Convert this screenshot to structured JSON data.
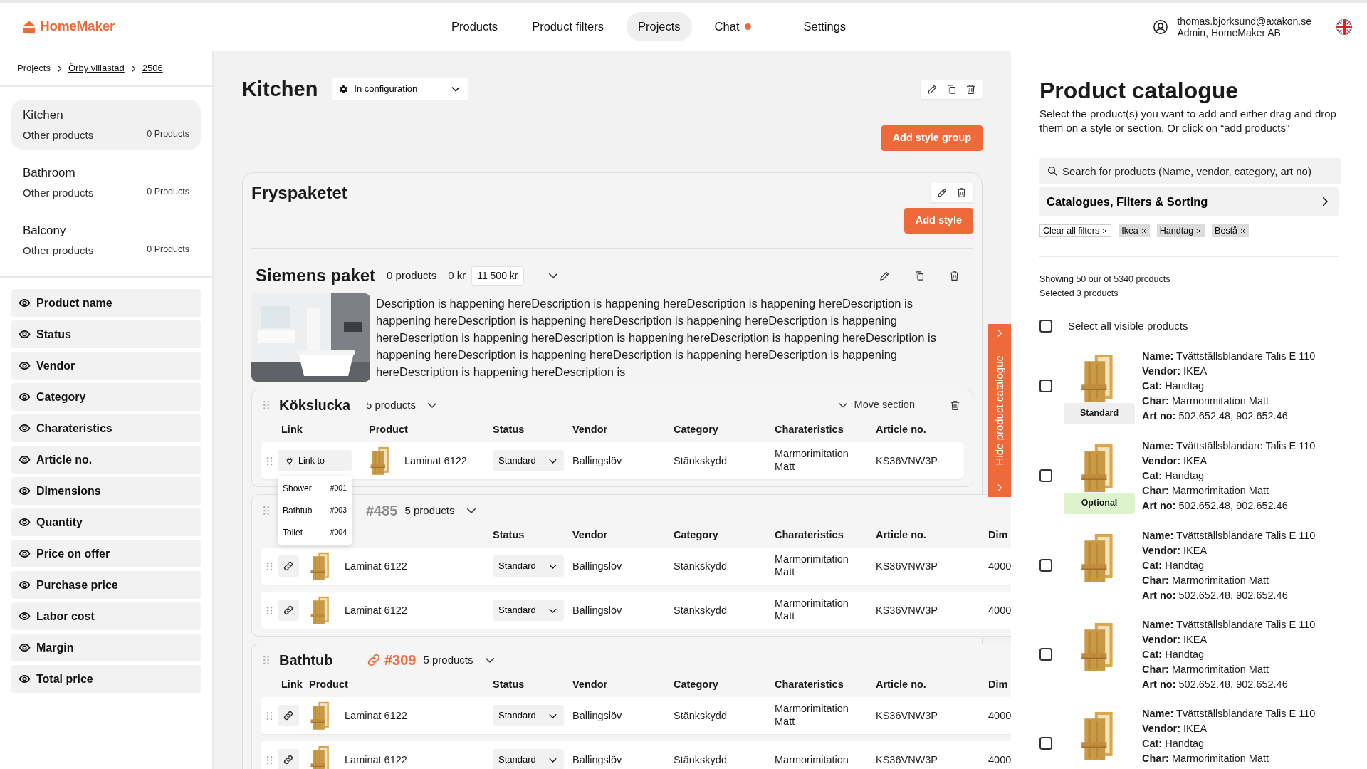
{
  "header": {
    "logo": "HomeMaker",
    "nav": [
      {
        "label": "Products",
        "selected": false,
        "unread": false
      },
      {
        "label": "Product filters",
        "selected": false,
        "unread": false
      },
      {
        "label": "Projects",
        "selected": true,
        "unread": false
      },
      {
        "label": "Chat",
        "selected": false,
        "unread": true
      }
    ],
    "settings": "Settings",
    "user": {
      "email": "thomas.bjorksund@axakon.se",
      "role": "Admin, HomeMaker AB"
    }
  },
  "breadcrumb": [
    {
      "label": "Projects",
      "link": false
    },
    {
      "label": "Örby villastad",
      "link": true
    },
    {
      "label": "2506",
      "link": true
    }
  ],
  "rooms": [
    {
      "name": "Kitchen",
      "label": "Other products",
      "count": "0 Products",
      "selected": true
    },
    {
      "name": "Bathroom",
      "label": "Other products",
      "count": "0 Products",
      "selected": false
    },
    {
      "name": "Balcony",
      "label": "Other products",
      "count": "0 Products",
      "selected": false
    }
  ],
  "column_toggles": [
    "Product name",
    "Status",
    "Vendor",
    "Category",
    "Charateristics",
    "Article no.",
    "Dimensions",
    "Quantity",
    "Price on offer",
    "Purchase price",
    "Labor cost",
    "Margin",
    "Total price"
  ],
  "room": {
    "title": "Kitchen",
    "status": "In configuration",
    "add_style_group": "Add style group"
  },
  "style_group": {
    "title": "Fryspaketet",
    "add_style": "Add style",
    "style": {
      "title": "Siemens paket",
      "products": "0 products",
      "price": "0 kr",
      "price_value": "11 500 kr",
      "description": "Description is happening hereDescription is happening hereDescription is happening hereDescription is happening hereDescription is happening hereDescription is happening hereDescription is happening hereDescription is happening hereDescription is happening hereDescription is happening hereDescription is happening hereDescription is happening hereDescription is happening hereDescription is happening hereDescription is happening hereDescription is",
      "sections": [
        {
          "title": "Kökslucka",
          "count": "5 products",
          "move": "Move section",
          "columns": [
            {
              "kind": "link",
              "label": "Link"
            },
            {
              "kind": "product",
              "label": "Product"
            },
            {
              "kind": "status",
              "label": "Status"
            },
            {
              "kind": "vendor",
              "label": "Vendor"
            },
            {
              "kind": "category",
              "label": "Category"
            },
            {
              "kind": "char",
              "label": "Charateristics"
            },
            {
              "kind": "article",
              "label": "Article no."
            }
          ],
          "rows": [
            {
              "name": "Laminat 6122",
              "status": "Standard",
              "vendor": "Ballingslöv",
              "category": "Stänkskydd",
              "characteristics": "Marmorimitation Matt",
              "article_no": "KS36VNW3P",
              "link_label": "Link to",
              "link_menu": [
                {
                  "name": "Shower",
                  "tag": "#001"
                },
                {
                  "name": "Bathtub",
                  "tag": "#003"
                },
                {
                  "name": "Toilet",
                  "tag": "#004"
                }
              ]
            }
          ]
        },
        {
          "tag": "#485",
          "linked": false,
          "count": "5 products",
          "columns": [
            {
              "kind": "status",
              "label": "Status"
            },
            {
              "kind": "vendor",
              "label": "Vendor"
            },
            {
              "kind": "category",
              "label": "Category"
            },
            {
              "kind": "char",
              "label": "Charateristics"
            },
            {
              "kind": "article",
              "label": "Article no."
            },
            {
              "kind": "dim",
              "label": "Dim"
            }
          ],
          "rows": [
            {
              "name": "Laminat 6122",
              "status": "Standard",
              "vendor": "Ballingslöv",
              "category": "Stänkskydd",
              "characteristics": "Marmorimitation Matt",
              "article_no": "KS36VNW3P",
              "dimensions": "4000"
            },
            {
              "name": "Laminat 6122",
              "status": "Standard",
              "vendor": "Ballingslöv",
              "category": "Stänkskydd",
              "characteristics": "Marmorimitation Matt",
              "article_no": "KS36VNW3P",
              "dimensions": "4000"
            }
          ]
        },
        {
          "title": "Bathtub",
          "tag": "#309",
          "linked": true,
          "count": "5 products",
          "columns": [
            {
              "kind": "link",
              "label": "Link"
            },
            {
              "kind": "product",
              "label": "Product"
            },
            {
              "kind": "status",
              "label": "Status"
            },
            {
              "kind": "vendor",
              "label": "Vendor"
            },
            {
              "kind": "category",
              "label": "Category"
            },
            {
              "kind": "char",
              "label": "Charateristics"
            },
            {
              "kind": "article",
              "label": "Article no."
            },
            {
              "kind": "dim",
              "label": "Dim"
            }
          ],
          "rows": [
            {
              "name": "Laminat 6122",
              "status": "Standard",
              "vendor": "Ballingslöv",
              "category": "Stänkskydd",
              "characteristics": "Marmorimitation Matt",
              "article_no": "KS36VNW3P",
              "dimensions": "4000"
            },
            {
              "name": "Laminat 6122",
              "status": "Standard",
              "vendor": "Ballingslöv",
              "category": "Stänkskydd",
              "characteristics": "Marmorimitation",
              "article_no": "KS36VNW3P",
              "dimensions": "4000"
            }
          ]
        }
      ]
    }
  },
  "catalogue_tab": "Hide product catalogue",
  "catalogue": {
    "title": "Product catalogue",
    "description": "Select the product(s) you want to add and either drag and drop them on a style or section. Or click on “add products”",
    "search": {
      "placeholder": "Search for products (Name, vendor, category, art no)"
    },
    "filters_button": "Catalogues, Filters & Sorting",
    "chips": [
      {
        "kind": "clear",
        "label": "Clear all filters"
      },
      {
        "kind": "filter",
        "label": "Ikea"
      },
      {
        "kind": "filter",
        "label": "Handtag"
      },
      {
        "kind": "filter",
        "label": "Bestå"
      }
    ],
    "showing": "Showing 50 our of 5340 products",
    "selected_count": "Selected 3 products",
    "select_all": {
      "label": "Select all visible products",
      "checked": false
    },
    "items": [
      {
        "checked": false,
        "badge": {
          "label": "Standard",
          "color": "#eeeeee"
        },
        "lines": [
          "**Name:** Tvättställsblandare Talis E 110",
          "**Vendor:** IKEA",
          "**Cat:** Handtag",
          "**Char:** Marmorimitation Matt",
          "**Art no:** 502.652.48, 902.652.46"
        ]
      },
      {
        "checked": false,
        "badge": {
          "label": "Optional",
          "color": "#dcf3cc"
        },
        "lines": [
          "**Name:** Tvättställsblandare Talis E 110",
          "**Vendor:** IKEA",
          "**Cat:** Handtag",
          "**Char:** Marmorimitation Matt",
          "**Art no:** 502.652.48, 902.652.46"
        ]
      },
      {
        "checked": false,
        "lines": [
          "**Name:** Tvättställsblandare Talis E 110",
          "**Vendor:** IKEA",
          "**Cat:** Handtag",
          "**Char:** Marmorimitation Matt",
          "**Art no:** 502.652.48, 902.652.46"
        ]
      },
      {
        "checked": false,
        "lines": [
          "**Name:** Tvättställsblandare Talis E 110",
          "**Vendor:** IKEA",
          "**Cat:** Handtag",
          "**Char:** Marmorimitation Matt",
          "**Art no:** 502.652.48, 902.652.46"
        ]
      },
      {
        "checked": false,
        "lines": [
          "**Name:** Tvättställsblandare Talis E 110",
          "**Vendor:** IKEA",
          "**Cat:** Handtag",
          "**Char:** Marmorimitation Matt"
        ]
      }
    ]
  }
}
